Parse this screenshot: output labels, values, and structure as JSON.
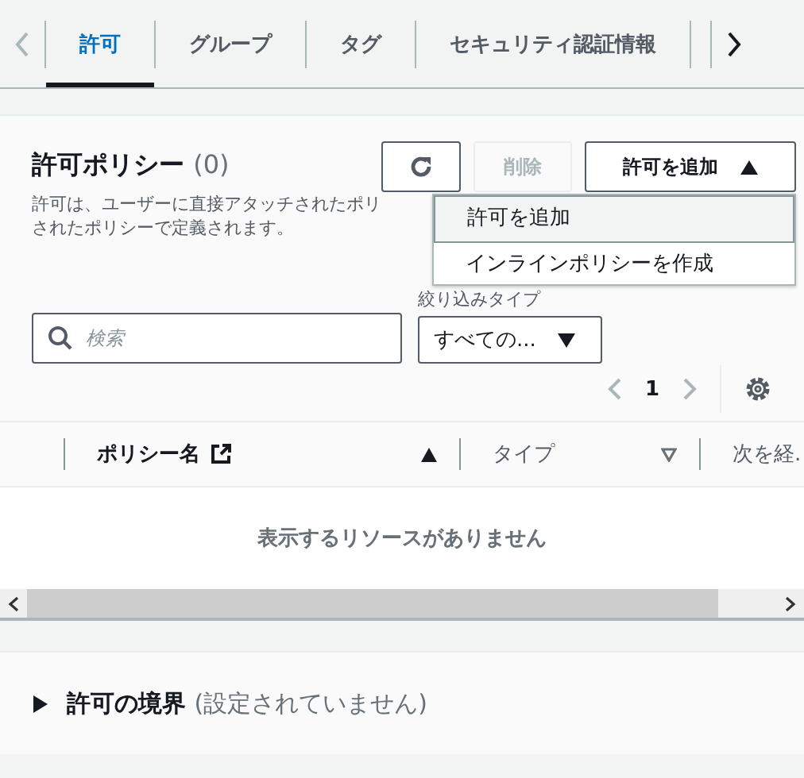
{
  "tabs": [
    {
      "label": "許可",
      "selected": true
    },
    {
      "label": "グループ",
      "selected": false
    },
    {
      "label": "タグ",
      "selected": false
    },
    {
      "label": "セキュリティ認証情報",
      "selected": false
    }
  ],
  "panel": {
    "title": "許可ポリシー",
    "count": "(0)",
    "description_lines": [
      "許可は、ユーザーに直接アタッチされたポリ",
      "されたポリシーで定義されます。"
    ],
    "buttons": [
      {
        "kind": "refresh"
      },
      {
        "kind": "text",
        "label": "削除",
        "disabled": true
      },
      {
        "kind": "menu",
        "label": "許可を追加",
        "expanded": true
      }
    ],
    "menu_items": [
      {
        "label": "許可を追加",
        "selected": true
      },
      {
        "label": "インラインポリシーを作成",
        "selected": false
      }
    ],
    "filter_label": "絞り込みタイプ",
    "search": {
      "placeholder": "検索"
    },
    "filter_select": {
      "value": "すべての..."
    },
    "page": "1",
    "table": {
      "columns": [
        {
          "label": "ポリシー名",
          "sorted": true,
          "link": true
        },
        {
          "label": "タイプ",
          "sorted": false,
          "link": false
        },
        {
          "label": "次を経.",
          "link": false
        }
      ],
      "empty_text": "表示するリソースがありません"
    }
  },
  "boundary": {
    "title": "許可の境界",
    "status": "(設定されていません)",
    "expanded": false
  }
}
